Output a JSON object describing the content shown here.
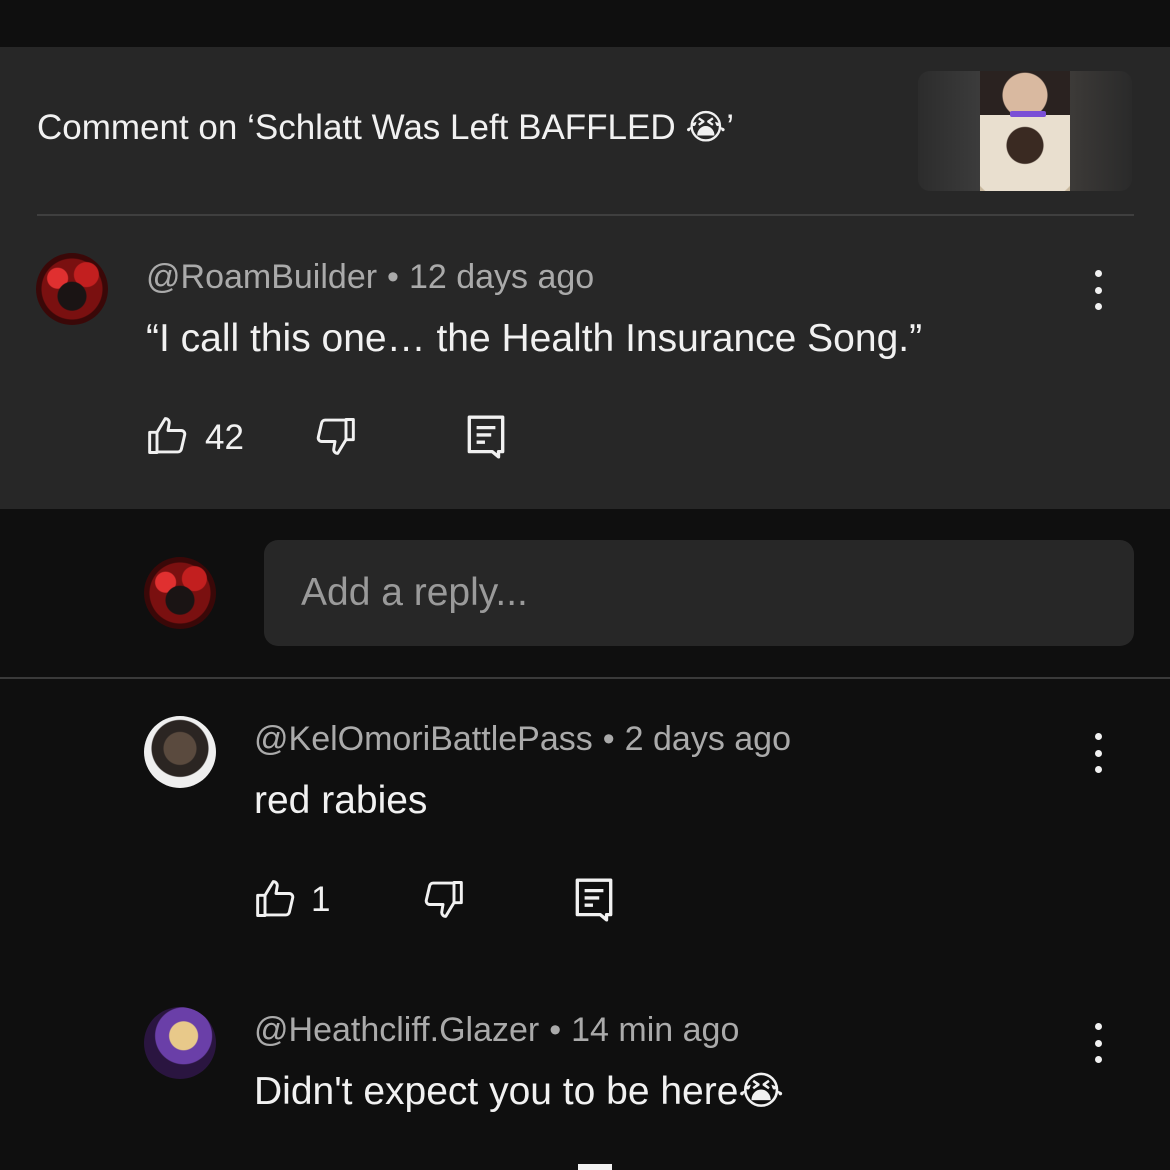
{
  "header": {
    "title": "Comment on ‘Schlatt Was Left BAFFLED 😭’"
  },
  "main_comment": {
    "author": "@RoamBuilder",
    "time": "12 days ago",
    "text": "“I call this one… the Health Insurance Song.”",
    "likes": "42"
  },
  "reply_input": {
    "placeholder": "Add a reply..."
  },
  "replies": [
    {
      "author": "@KelOmoriBattlePass",
      "time": "2 days ago",
      "text": "red rabies",
      "likes": "1"
    },
    {
      "author": "@Heathcliff.Glazer",
      "time": "14 min ago",
      "text": "Didn't expect you to be here😭"
    }
  ],
  "icons": [
    "thumbs-up-icon",
    "thumbs-down-icon",
    "reply-icon",
    "more-vert-icon"
  ],
  "colors": {
    "background": "#0f0f0f",
    "panel": "#272727",
    "text_primary": "#f1f1f1",
    "text_secondary": "#aaaaaa"
  }
}
